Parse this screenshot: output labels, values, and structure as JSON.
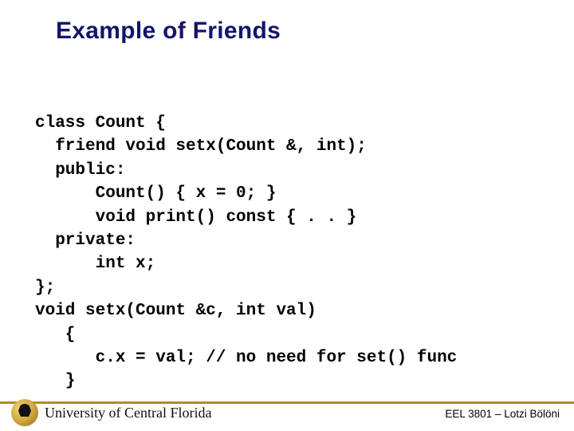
{
  "title": "Example of Friends",
  "code": {
    "l1": "class Count {",
    "l2": "  friend void setx(Count &, int);",
    "l3": "  public:",
    "l4": "      Count() { x = 0; }",
    "l5": "      void print() const { . . }",
    "l6": "  private:",
    "l7": "      int x;",
    "l8": "};",
    "l9": "void setx(Count &c, int val)",
    "l10": "   {",
    "l11": "      c.x = val; // no need for set() func",
    "l12": "   }"
  },
  "footer": {
    "university": "University of Central Florida",
    "course": "EEL 3801 – Lotzi Bölöni"
  }
}
